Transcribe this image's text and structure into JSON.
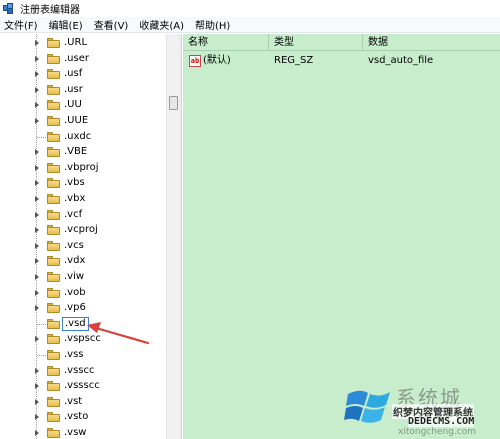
{
  "window": {
    "title": "注册表编辑器"
  },
  "menu": {
    "items": [
      {
        "label": "文件(F)"
      },
      {
        "label": "编辑(E)"
      },
      {
        "label": "查看(V)"
      },
      {
        "label": "收藏夹(A)"
      },
      {
        "label": "帮助(H)"
      }
    ]
  },
  "tree": {
    "items": [
      {
        "label": ".URL",
        "expandable": true,
        "selected": false
      },
      {
        "label": ".user",
        "expandable": true,
        "selected": false
      },
      {
        "label": ".usf",
        "expandable": true,
        "selected": false
      },
      {
        "label": ".usr",
        "expandable": true,
        "selected": false
      },
      {
        "label": ".UU",
        "expandable": true,
        "selected": false
      },
      {
        "label": ".UUE",
        "expandable": true,
        "selected": false
      },
      {
        "label": ".uxdc",
        "expandable": false,
        "selected": false
      },
      {
        "label": ".VBE",
        "expandable": true,
        "selected": false
      },
      {
        "label": ".vbproj",
        "expandable": true,
        "selected": false
      },
      {
        "label": ".vbs",
        "expandable": true,
        "selected": false
      },
      {
        "label": ".vbx",
        "expandable": true,
        "selected": false
      },
      {
        "label": ".vcf",
        "expandable": true,
        "selected": false
      },
      {
        "label": ".vcproj",
        "expandable": true,
        "selected": false
      },
      {
        "label": ".vcs",
        "expandable": true,
        "selected": false
      },
      {
        "label": ".vdx",
        "expandable": true,
        "selected": false
      },
      {
        "label": ".viw",
        "expandable": true,
        "selected": false
      },
      {
        "label": ".vob",
        "expandable": true,
        "selected": false
      },
      {
        "label": ".vp6",
        "expandable": true,
        "selected": false
      },
      {
        "label": ".vsd",
        "expandable": false,
        "selected": true
      },
      {
        "label": ".vspscc",
        "expandable": true,
        "selected": false
      },
      {
        "label": ".vss",
        "expandable": false,
        "selected": false
      },
      {
        "label": ".vsscc",
        "expandable": true,
        "selected": false
      },
      {
        "label": ".vssscc",
        "expandable": true,
        "selected": false
      },
      {
        "label": ".vst",
        "expandable": true,
        "selected": false
      },
      {
        "label": ".vsto",
        "expandable": true,
        "selected": false
      },
      {
        "label": ".vsw",
        "expandable": true,
        "selected": false
      }
    ]
  },
  "list": {
    "columns": [
      "名称",
      "类型",
      "数据"
    ],
    "rows": [
      {
        "icon": "string-value-icon",
        "icon_text": "ab",
        "name": "(默认)",
        "type": "REG_SZ",
        "data": "vsd_auto_file"
      }
    ],
    "background_color": "#c7edcc"
  },
  "annotation": {
    "color": "#d9423a",
    "icon": "red-arrow-icon"
  },
  "watermark": {
    "big_text": "系统城",
    "label": "织梦内容管理系统",
    "url": "DEDECMS.COM",
    "small_text": "xitongcheng.com"
  }
}
